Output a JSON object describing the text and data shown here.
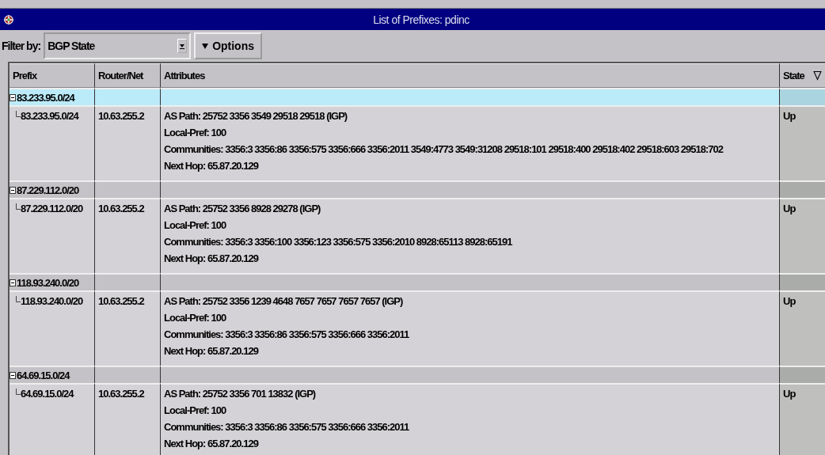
{
  "window": {
    "title": "List of Prefixes: pdinc"
  },
  "filter": {
    "label": "Filter by:",
    "value": "BGP State"
  },
  "options_button": {
    "label": "Options"
  },
  "table": {
    "columns": [
      "Prefix",
      "Router/Net",
      "Attributes",
      "State"
    ],
    "groups": [
      {
        "prefix": "83.233.95.0/24",
        "expanded": true,
        "selected": true,
        "children": [
          {
            "prefix": "83.233.95.0/24",
            "router": "10.63.255.2",
            "attributes": [
              "AS Path: 25752 3356 3549 29518 29518 (IGP)",
              "Local-Pref: 100",
              "Communities: 3356:3 3356:86 3356:575 3356:666 3356:2011 3549:4773 3549:31208 29518:101 29518:400 29518:402 29518:603 29518:702",
              "Next Hop: 65.87.20.129"
            ],
            "state": "Up"
          }
        ]
      },
      {
        "prefix": "87.229.112.0/20",
        "expanded": true,
        "selected": false,
        "children": [
          {
            "prefix": "87.229.112.0/20",
            "router": "10.63.255.2",
            "attributes": [
              "AS Path: 25752 3356 8928 29278 (IGP)",
              "Local-Pref: 100",
              "Communities: 3356:3 3356:100 3356:123 3356:575 3356:2010 8928:65113 8928:65191",
              "Next Hop: 65.87.20.129"
            ],
            "state": "Up"
          }
        ]
      },
      {
        "prefix": "118.93.240.0/20",
        "expanded": true,
        "selected": false,
        "children": [
          {
            "prefix": "118.93.240.0/20",
            "router": "10.63.255.2",
            "attributes": [
              "AS Path: 25752 3356 1239 4648 7657 7657 7657 7657 (IGP)",
              "Local-Pref: 100",
              "Communities: 3356:3 3356:86 3356:575 3356:666 3356:2011",
              "Next Hop: 65.87.20.129"
            ],
            "state": "Up"
          }
        ]
      },
      {
        "prefix": "64.69.15.0/24",
        "expanded": true,
        "selected": false,
        "children": [
          {
            "prefix": "64.69.15.0/24",
            "router": "10.63.255.2",
            "attributes": [
              "AS Path: 25752 3356 701 13832 (IGP)",
              "Local-Pref: 100",
              "Communities: 3356:3 3356:86 3356:575 3356:666 3356:2011",
              "Next Hop: 65.87.20.129"
            ],
            "state": "Up"
          }
        ]
      }
    ]
  }
}
